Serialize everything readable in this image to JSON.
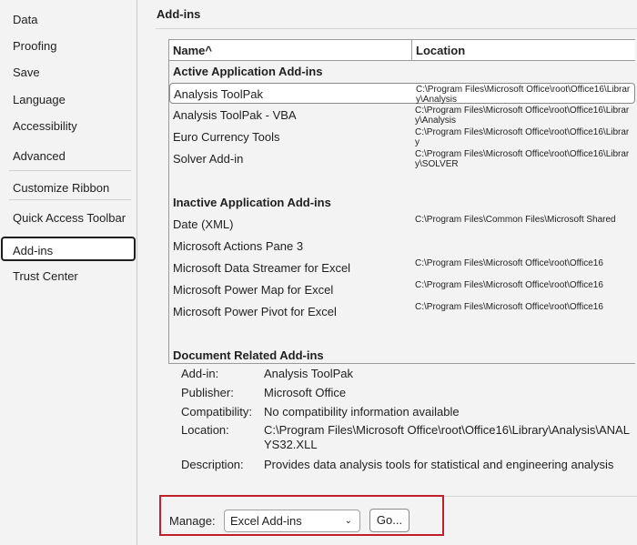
{
  "sidebar": {
    "items": [
      {
        "label": "Data",
        "selected": false
      },
      {
        "label": "Proofing",
        "selected": false
      },
      {
        "label": "Save",
        "selected": false
      },
      {
        "label": "Language",
        "selected": false
      },
      {
        "label": "Accessibility",
        "selected": false
      },
      {
        "label": "Advanced",
        "selected": false
      },
      {
        "label": "Customize Ribbon",
        "selected": false
      },
      {
        "label": "Quick Access Toolbar",
        "selected": false
      },
      {
        "label": "Add-ins",
        "selected": true
      },
      {
        "label": "Trust Center",
        "selected": false
      }
    ]
  },
  "main": {
    "title": "Add-ins",
    "table": {
      "columns": [
        "Name^",
        "Location"
      ],
      "rows": [
        {
          "type": "group",
          "name": "Active Application Add-ins",
          "location": ""
        },
        {
          "type": "item",
          "name": "Analysis ToolPak",
          "location": "C:\\Program Files\\Microsoft Office\\root\\Office16\\Library\\Analysis",
          "selected": true
        },
        {
          "type": "item",
          "name": "Analysis ToolPak - VBA",
          "location": "C:\\Program Files\\Microsoft Office\\root\\Office16\\Library\\Analysis"
        },
        {
          "type": "item",
          "name": "Euro Currency Tools",
          "location": "C:\\Program Files\\Microsoft Office\\root\\Office16\\Library"
        },
        {
          "type": "item",
          "name": "Solver Add-in",
          "location": "C:\\Program Files\\Microsoft Office\\root\\Office16\\Library\\SOLVER"
        },
        {
          "type": "blank",
          "name": "",
          "location": ""
        },
        {
          "type": "group",
          "name": "Inactive Application Add-ins",
          "location": ""
        },
        {
          "type": "item",
          "name": "Date (XML)",
          "location": "C:\\Program Files\\Common Files\\Microsoft Shared"
        },
        {
          "type": "item",
          "name": "Microsoft Actions Pane 3",
          "location": ""
        },
        {
          "type": "item",
          "name": "Microsoft Data Streamer for Excel",
          "location": "C:\\Program Files\\Microsoft Office\\root\\Office16"
        },
        {
          "type": "item",
          "name": "Microsoft Power Map for Excel",
          "location": "C:\\Program Files\\Microsoft Office\\root\\Office16"
        },
        {
          "type": "item",
          "name": "Microsoft Power Pivot for Excel",
          "location": "C:\\Program Files\\Microsoft Office\\root\\Office16"
        },
        {
          "type": "blank",
          "name": "",
          "location": ""
        },
        {
          "type": "group",
          "name": "Document Related Add-ins",
          "location": ""
        }
      ]
    },
    "details": [
      {
        "label": "Add-in:",
        "value": "Analysis ToolPak"
      },
      {
        "label": "Publisher:",
        "value": "Microsoft Office"
      },
      {
        "label": "Compatibility:",
        "value": "No compatibility information available"
      },
      {
        "label": "Location:",
        "value": "C:\\Program Files\\Microsoft Office\\root\\Office16\\Library\\Analysis\\ANALYS32.XLL"
      },
      {
        "label": "Description:",
        "value": "Provides data analysis tools for statistical and engineering analysis"
      }
    ],
    "manage": {
      "label": "Manage:",
      "selected": "Excel Add-ins",
      "go_label": "Go...",
      "highlight_color": "#c0202a"
    }
  }
}
